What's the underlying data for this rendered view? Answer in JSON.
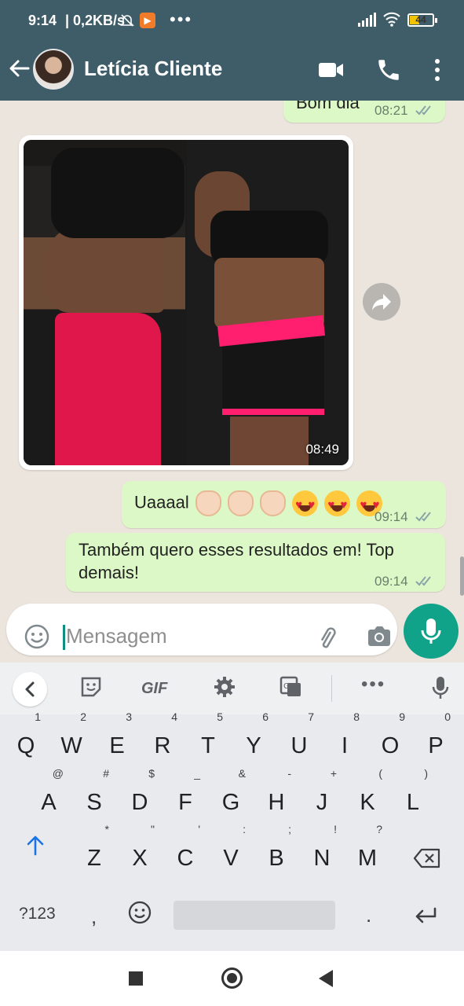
{
  "status_bar": {
    "time": "9:14",
    "speed": "| 0,2KB/s",
    "dots": "•••",
    "battery": "44",
    "battery_level": 0.44
  },
  "app_bar": {
    "contact_name": "Letícia Cliente"
  },
  "messages": [
    {
      "type": "text",
      "direction": "outgoing",
      "text": "Bom dia",
      "time": "08:21",
      "status": "read"
    },
    {
      "type": "image",
      "direction": "incoming",
      "time": "08:49"
    },
    {
      "type": "text",
      "direction": "outgoing",
      "text": "Uaaaal",
      "emojis": [
        "clap-icon",
        "clap-icon",
        "clap-icon",
        "heart-eyes-icon",
        "heart-eyes-icon",
        "heart-eyes-icon"
      ],
      "time": "09:14",
      "status": "read"
    },
    {
      "type": "text",
      "direction": "outgoing",
      "text_line1": "Também quero esses resultados em! Top",
      "text_line2": "demais!",
      "time": "09:14",
      "status": "read"
    }
  ],
  "input": {
    "placeholder": "Mensagem"
  },
  "keyboard": {
    "toolbar": {
      "gif_label": "GIF",
      "more_label": "•••"
    },
    "row1": [
      {
        "key": "Q",
        "hint": "1"
      },
      {
        "key": "W",
        "hint": "2"
      },
      {
        "key": "E",
        "hint": "3"
      },
      {
        "key": "R",
        "hint": "4"
      },
      {
        "key": "T",
        "hint": "5"
      },
      {
        "key": "Y",
        "hint": "6"
      },
      {
        "key": "U",
        "hint": "7"
      },
      {
        "key": "I",
        "hint": "8"
      },
      {
        "key": "O",
        "hint": "9"
      },
      {
        "key": "P",
        "hint": "0"
      }
    ],
    "row2": [
      {
        "key": "A",
        "hint": "@"
      },
      {
        "key": "S",
        "hint": "#"
      },
      {
        "key": "D",
        "hint": "$"
      },
      {
        "key": "F",
        "hint": "_"
      },
      {
        "key": "G",
        "hint": "&"
      },
      {
        "key": "H",
        "hint": "-"
      },
      {
        "key": "J",
        "hint": "+"
      },
      {
        "key": "K",
        "hint": "("
      },
      {
        "key": "L",
        "hint": ")"
      }
    ],
    "row3": [
      {
        "key": "Z",
        "hint": "*"
      },
      {
        "key": "X",
        "hint": "\""
      },
      {
        "key": "C",
        "hint": "'"
      },
      {
        "key": "V",
        "hint": ":"
      },
      {
        "key": "B",
        "hint": ";"
      },
      {
        "key": "N",
        "hint": "!"
      },
      {
        "key": "M",
        "hint": "?"
      }
    ],
    "row4": {
      "symbols_label": "?123",
      "comma": ",",
      "period": "."
    }
  }
}
